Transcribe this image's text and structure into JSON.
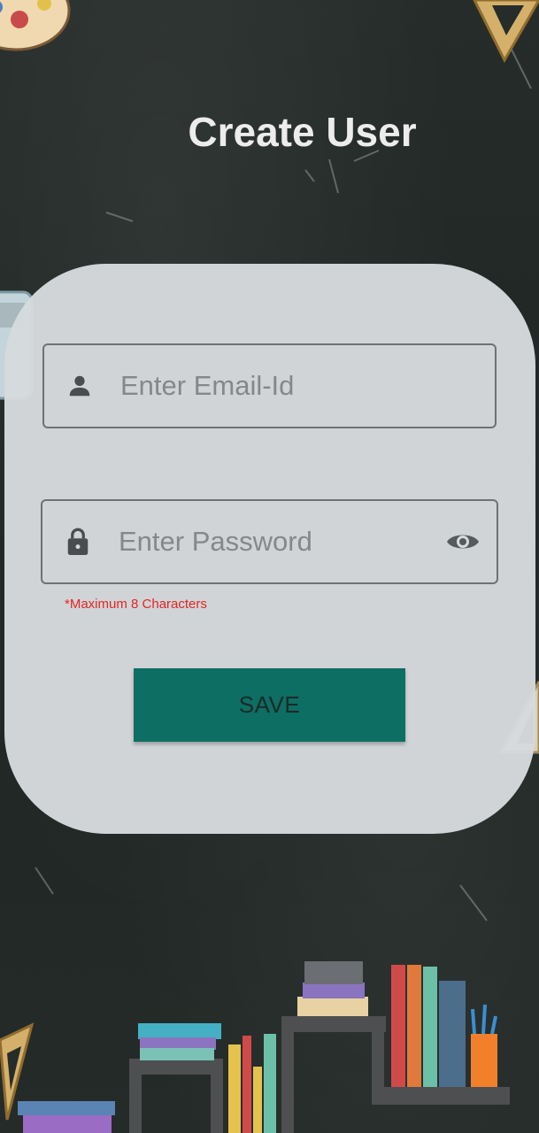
{
  "title": "Create User",
  "form": {
    "email": {
      "placeholder": "Enter Email-Id",
      "value": "",
      "icon": "person-icon"
    },
    "password": {
      "placeholder": "Enter Password",
      "value": "",
      "icon": "lock-icon",
      "toggle_icon": "eye-icon"
    },
    "hint": "*Maximum 8 Characters",
    "save_label": "SAVE"
  },
  "colors": {
    "background": "#222826",
    "card": "#d6dadd",
    "button": "#0d6e63",
    "hint": "#e52521",
    "title": "#ececec"
  }
}
